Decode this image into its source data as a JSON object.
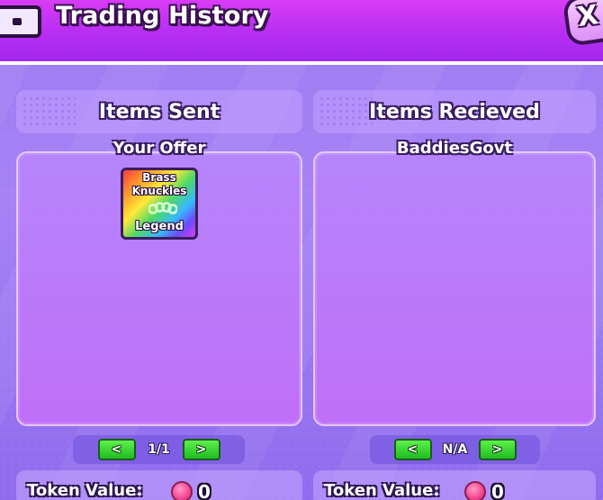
{
  "window": {
    "title": "Trading History",
    "close_label": "X",
    "close_icon": "close-icon",
    "title_icon": "chest-icon"
  },
  "sent": {
    "header": "Items Sent",
    "owner": "Your Offer",
    "items": [
      {
        "name_line1": "Brass",
        "name_line2": "Knuckles",
        "rarity": "Legend",
        "icon": "brass-knuckles-icon"
      }
    ],
    "pager": {
      "prev": "<",
      "next": ">",
      "page_text": "1/1"
    },
    "token_label": "Token Value:",
    "token_icon": "token-coin-icon",
    "token_value": "0"
  },
  "received": {
    "header": "Items Recieved",
    "owner": "BaddiesGovt",
    "items": [],
    "pager": {
      "prev": "<",
      "next": ">",
      "page_text": "N/A"
    },
    "token_label": "Token Value:",
    "token_icon": "token-coin-icon",
    "token_value": "0"
  },
  "colors": {
    "title_bar": "#c232f4",
    "panel": "#b97cf9",
    "button_green": "#2fd12e",
    "token_pink": "#f2458f"
  }
}
